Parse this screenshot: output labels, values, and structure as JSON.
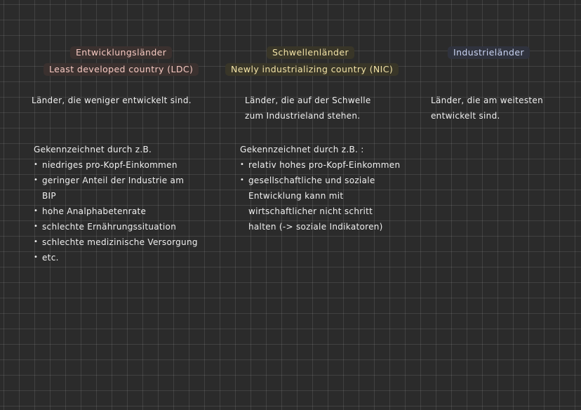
{
  "columns": [
    {
      "heading": "Entwicklungsländer",
      "subheading": "Least developed country (LDC)",
      "definition": [
        "Länder, die weniger entwickelt sind."
      ],
      "characteristics_label": "Gekennzeichnet durch z.B.",
      "characteristics": [
        "niedriges pro-Kopf-Einkommen",
        "geringer Anteil der Industrie am",
        "BIP",
        "hohe Analphabetenrate",
        "schlechte Ernährungssituation",
        "schlechte medizinische Versorgung",
        "etc."
      ]
    },
    {
      "heading": "Schwellenländer",
      "subheading": "Newly industrializing country (NIC)",
      "definition": [
        "Länder, die auf der Schwelle",
        "zum Industrieland stehen."
      ],
      "characteristics_label": "Gekennzeichnet durch z.B. :",
      "characteristics": [
        "relativ hohes pro-Kopf-Einkommen",
        "gesellschaftliche und soziale",
        "Entwicklung kann mit",
        "wirtschaftlicher nicht schritt",
        "halten (-> soziale Indikatoren)"
      ]
    },
    {
      "heading": "Industrieländer",
      "definition": [
        "Länder, die am weitesten",
        "entwickelt sind."
      ]
    }
  ],
  "colors": {
    "background": "#2b2b2b",
    "heading_pink": "#f6c9c2",
    "heading_yellow": "#f1e2a6",
    "heading_blue": "#c9d3f2"
  }
}
